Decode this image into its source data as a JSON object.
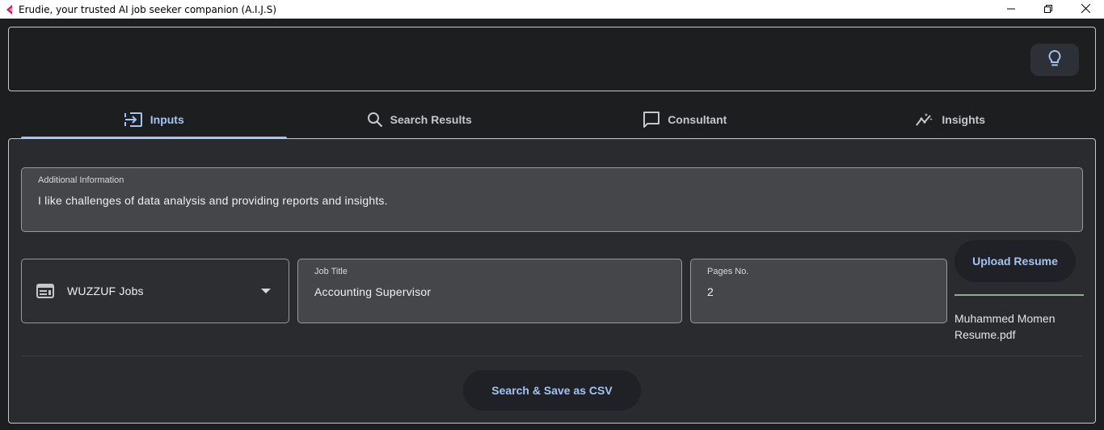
{
  "window": {
    "title": "Erudie, your trusted AI job seeker companion (A.I.J.S)"
  },
  "colors": {
    "accent": "#a3c4f3",
    "background": "#1d1e20",
    "panel": "#2a2b2e",
    "field": "#45464a"
  },
  "icons": {
    "app": "app-logo-icon",
    "theme": "lightbulb-icon",
    "minimize": "minimize-icon",
    "restore": "restore-icon",
    "close": "close-icon"
  },
  "tabs": [
    {
      "label": "Inputs",
      "icon": "input-icon",
      "active": true
    },
    {
      "label": "Search Results",
      "icon": "search-icon",
      "active": false
    },
    {
      "label": "Consultant",
      "icon": "chat-icon",
      "active": false
    },
    {
      "label": "Insights",
      "icon": "insights-icon",
      "active": false
    }
  ],
  "form": {
    "additional_info": {
      "label": "Additional Information",
      "value": "I like challenges of data analysis and providing reports and insights."
    },
    "source": {
      "value": "WUZZUF Jobs",
      "icon": "web-icon"
    },
    "job_title": {
      "label": "Job Title",
      "value": "Accounting Supervisor"
    },
    "pages": {
      "label": "Pages No.",
      "value": "2"
    },
    "upload": {
      "button_label": "Upload Resume",
      "file_name": "Muhammed Momen Resume.pdf"
    },
    "search_button": "Search & Save as CSV"
  }
}
